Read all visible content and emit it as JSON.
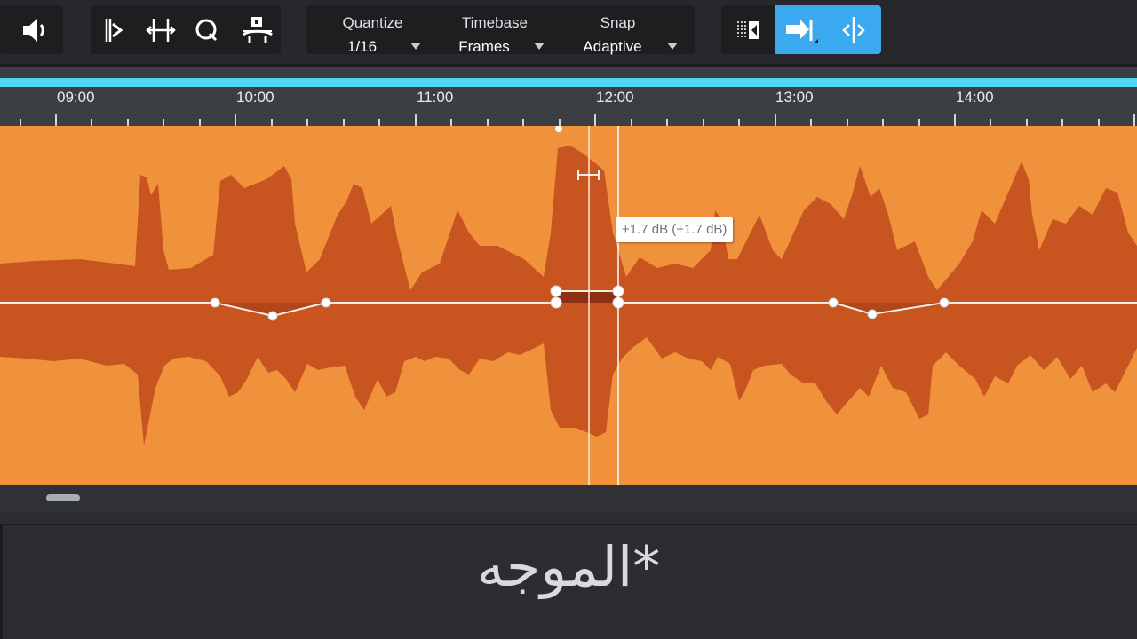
{
  "toolbar": {
    "quantize": {
      "label": "Quantize",
      "value": "1/16"
    },
    "timebase": {
      "label": "Timebase",
      "value": "Frames"
    },
    "snap": {
      "label": "Snap",
      "value": "Adaptive"
    }
  },
  "ruler": {
    "labels": [
      "09:00",
      "10:00",
      "11:00",
      "12:00",
      "13:00",
      "14:00"
    ]
  },
  "tooltip": {
    "text": "+1.7 dB (+1.7 dB)"
  },
  "caption": {
    "text": "*الموجه"
  },
  "colors": {
    "region": "#f0913c",
    "waveform": "#c8541f",
    "ruler_bar": "#4fd8f0",
    "active_tool": "#3aa9f0"
  }
}
